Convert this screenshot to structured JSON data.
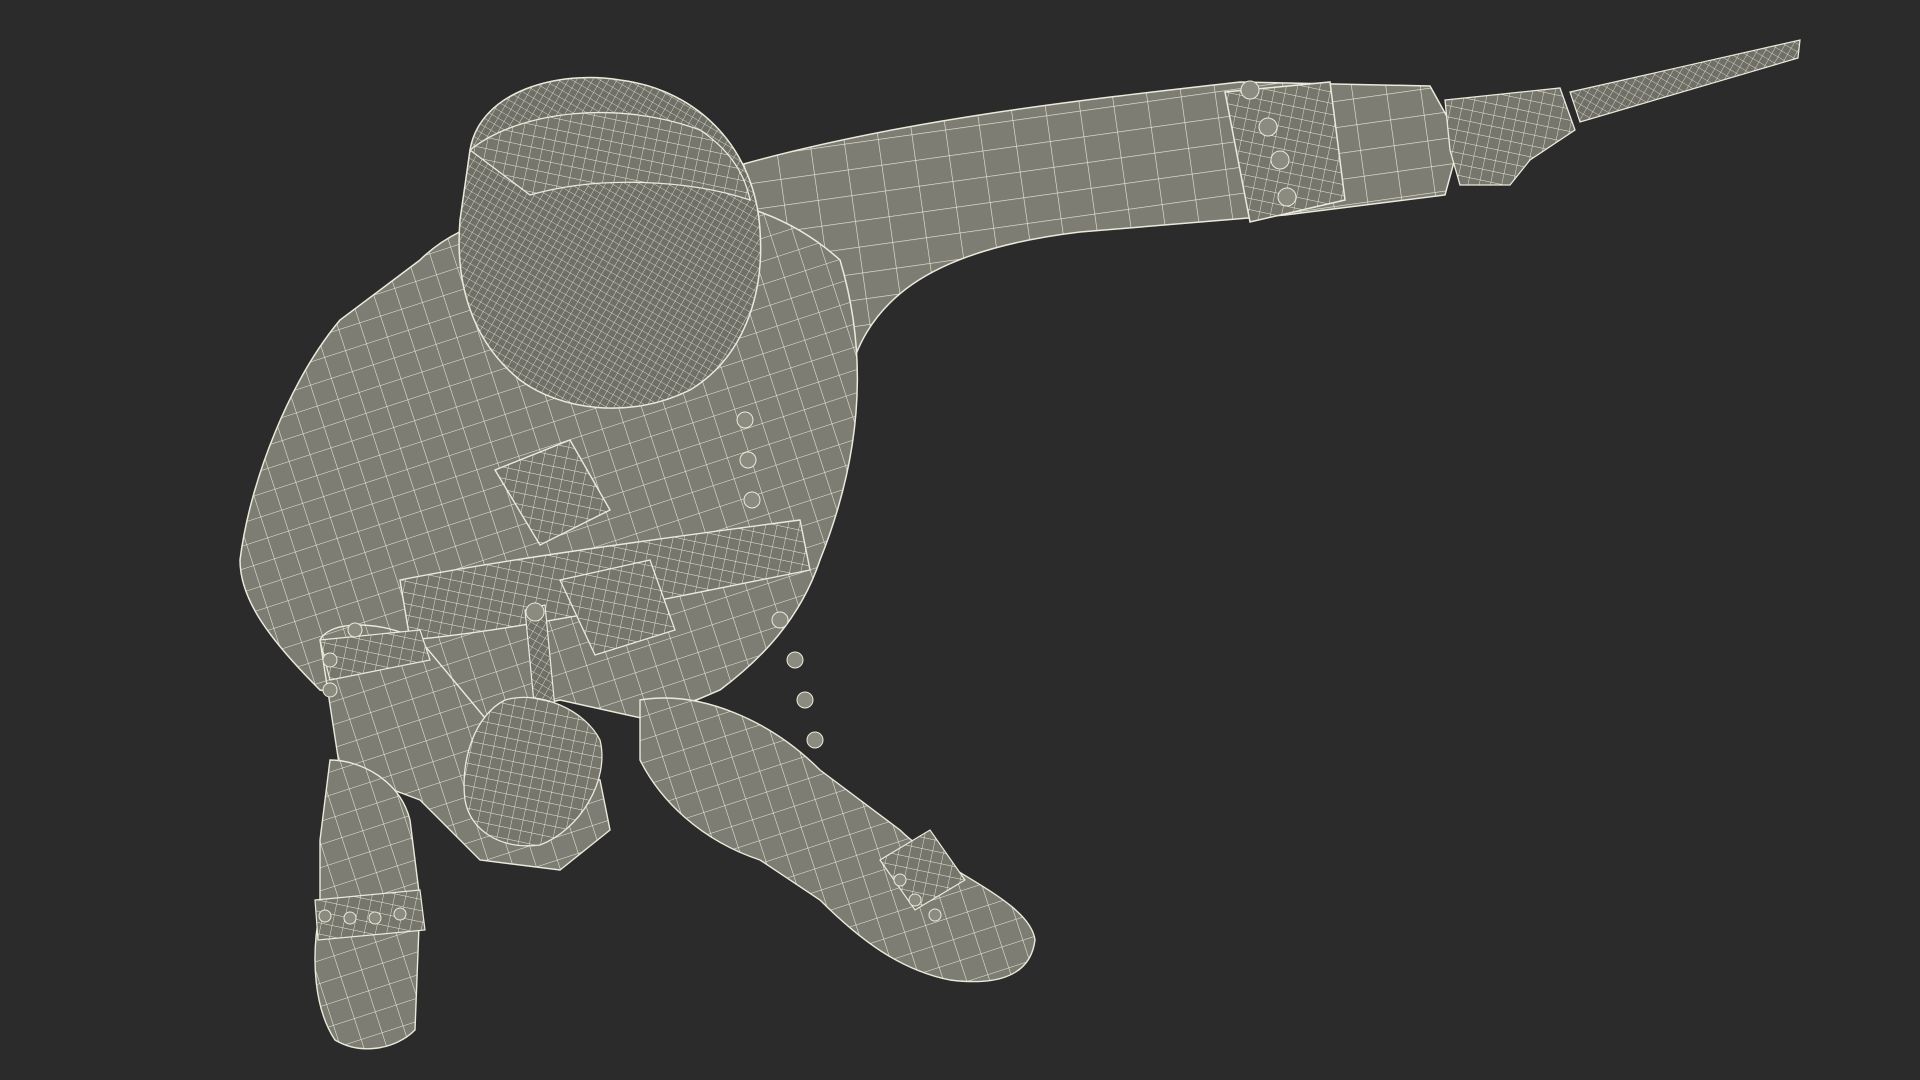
{
  "scene": {
    "background_color": "#2b2b2b",
    "mesh_fill_color": "#7d7d74",
    "mesh_shadow_color": "#5f5f58",
    "wire_color": "#eaeadb",
    "subject": "wireframe-pirate-figure"
  }
}
